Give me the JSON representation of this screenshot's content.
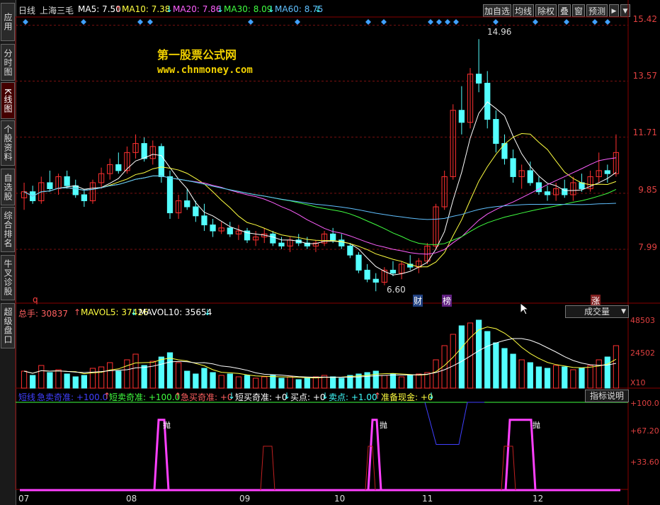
{
  "sidebar": {
    "tabs": [
      {
        "label": "应用",
        "active": false
      },
      {
        "label": "分时图",
        "active": false
      },
      {
        "label": "K线图",
        "active": true
      },
      {
        "label": "个股资料",
        "active": false
      },
      {
        "label": "自选股",
        "active": false
      },
      {
        "label": "综合排名",
        "active": false
      },
      {
        "label": "牛叉诊股",
        "active": false
      },
      {
        "label": "超级盘口",
        "active": false
      }
    ]
  },
  "main_header": {
    "period": "日线",
    "stock_name": "上海三毛",
    "ma5": "MA5: 7.50",
    "ma10": "MA10: 7.38",
    "ma20": "MA20: 7.86",
    "ma30": "MA30: 8.09",
    "ma60": "MA60: 8.75",
    "arrow_down": "↓",
    "arrow_up": "↑"
  },
  "toolbar": {
    "add_watch": "加自选",
    "avg_line": "均线",
    "exright": "除权",
    "overlay": "叠",
    "window": "窗",
    "forecast": "预测",
    "arrow": "▶",
    "menu": "▼"
  },
  "watermark": {
    "title": "第一股票公式网",
    "url": "www.chnmoney.com"
  },
  "price_axis": [
    "15.42",
    "13.57",
    "11.71",
    "9.85",
    "7.99"
  ],
  "annotations": {
    "high": "14.96",
    "low": "6.60",
    "marker_q": "q",
    "marker_cai": "财",
    "marker_bang": "榜",
    "marker_zhang": "涨"
  },
  "volume_header": {
    "total": "总手: 30837",
    "mavol5": "MAVOL5: 37426",
    "mavol10": "MAVOL10: 35654",
    "selector": "成交量",
    "axis": [
      "48503",
      "24502"
    ],
    "unit": "X10"
  },
  "indicator_header": {
    "l1": "短线",
    "l1b": "急卖奇准: +100.0",
    "l2": "短卖奇准: +100.0",
    "l3": "急买奇准: +0",
    "l4": "短买奇准: +0",
    "l5": "买点: +0",
    "l6": "卖点: +1.00",
    "l7": "准备现金: +0",
    "help": "指标说明",
    "axis": [
      "+100.0",
      "+67.20",
      "+33.60"
    ],
    "label_a": "抛",
    "label_b": "抛",
    "label_c": "抛"
  },
  "date_axis": [
    "07",
    "08",
    "09",
    "10",
    "11",
    "12"
  ],
  "colors": {
    "up": "#ff3030",
    "down": "#54ffff",
    "ma5": "#ffffff",
    "ma10": "#ffff40",
    "ma20": "#ff60ff",
    "ma30": "#40ff40",
    "ma60": "#60c0ff",
    "axis": "#e04040"
  },
  "chart_data": {
    "type": "candlestick",
    "ohlc": [
      [
        9.7,
        10.2,
        9.3,
        9.9
      ],
      [
        9.9,
        10.1,
        9.5,
        9.6
      ],
      [
        9.6,
        10.4,
        9.5,
        10.2
      ],
      [
        10.2,
        10.6,
        9.9,
        10.0
      ],
      [
        10.0,
        10.5,
        9.8,
        10.4
      ],
      [
        10.4,
        10.6,
        10.0,
        10.1
      ],
      [
        10.1,
        10.3,
        9.7,
        9.8
      ],
      [
        9.8,
        10.0,
        9.4,
        9.6
      ],
      [
        9.6,
        10.3,
        9.5,
        10.2
      ],
      [
        10.2,
        10.7,
        10.0,
        10.5
      ],
      [
        10.5,
        11.0,
        10.3,
        10.8
      ],
      [
        10.8,
        11.2,
        10.5,
        10.6
      ],
      [
        10.6,
        11.4,
        10.5,
        11.2
      ],
      [
        11.2,
        11.8,
        11.0,
        11.5
      ],
      [
        11.5,
        11.7,
        10.9,
        11.0
      ],
      [
        11.0,
        11.6,
        10.8,
        11.4
      ],
      [
        11.4,
        11.5,
        10.2,
        10.4
      ],
      [
        10.4,
        10.6,
        9.0,
        9.2
      ],
      [
        9.2,
        9.8,
        9.0,
        9.6
      ],
      [
        9.6,
        10.0,
        9.3,
        9.4
      ],
      [
        9.4,
        9.6,
        8.9,
        9.1
      ],
      [
        9.1,
        9.5,
        8.6,
        8.8
      ],
      [
        8.8,
        9.0,
        8.4,
        8.6
      ],
      [
        8.6,
        8.9,
        8.5,
        8.7
      ],
      [
        8.7,
        8.9,
        8.4,
        8.5
      ],
      [
        8.5,
        8.8,
        8.3,
        8.6
      ],
      [
        8.6,
        8.7,
        8.2,
        8.3
      ],
      [
        8.3,
        8.6,
        8.1,
        8.4
      ],
      [
        8.4,
        8.7,
        8.2,
        8.5
      ],
      [
        8.5,
        8.6,
        8.1,
        8.2
      ],
      [
        8.2,
        8.4,
        8.0,
        8.1
      ],
      [
        8.1,
        8.4,
        7.9,
        8.3
      ],
      [
        8.3,
        8.5,
        8.1,
        8.2
      ],
      [
        8.2,
        8.4,
        8.0,
        8.1
      ],
      [
        8.1,
        8.3,
        7.9,
        8.2
      ],
      [
        8.2,
        8.6,
        8.1,
        8.5
      ],
      [
        8.5,
        8.7,
        8.2,
        8.3
      ],
      [
        8.3,
        8.5,
        8.0,
        8.1
      ],
      [
        8.1,
        8.2,
        7.7,
        7.8
      ],
      [
        7.8,
        7.9,
        7.2,
        7.3
      ],
      [
        7.3,
        7.5,
        6.9,
        7.0
      ],
      [
        7.0,
        7.2,
        6.6,
        6.9
      ],
      [
        6.9,
        7.4,
        6.8,
        7.3
      ],
      [
        7.3,
        7.6,
        7.1,
        7.2
      ],
      [
        7.2,
        7.6,
        7.0,
        7.5
      ],
      [
        7.5,
        7.8,
        7.3,
        7.4
      ],
      [
        7.4,
        7.7,
        7.2,
        7.6
      ],
      [
        7.6,
        8.2,
        7.5,
        8.1
      ],
      [
        8.1,
        9.5,
        8.0,
        9.4
      ],
      [
        9.4,
        10.6,
        9.3,
        10.4
      ],
      [
        10.4,
        12.8,
        10.3,
        12.6
      ],
      [
        12.6,
        13.4,
        11.8,
        12.2
      ],
      [
        12.2,
        14.0,
        12.0,
        13.8
      ],
      [
        13.8,
        14.96,
        13.2,
        13.5
      ],
      [
        13.5,
        13.9,
        12.0,
        12.3
      ],
      [
        12.3,
        12.6,
        11.2,
        11.5
      ],
      [
        11.5,
        11.8,
        10.8,
        11.0
      ],
      [
        11.0,
        11.3,
        10.2,
        10.4
      ],
      [
        10.4,
        10.8,
        10.0,
        10.6
      ],
      [
        10.6,
        10.9,
        10.1,
        10.2
      ],
      [
        10.2,
        10.4,
        9.8,
        9.9
      ],
      [
        9.9,
        10.1,
        9.6,
        9.8
      ],
      [
        9.8,
        10.2,
        9.6,
        10.0
      ],
      [
        10.0,
        10.3,
        9.7,
        9.8
      ],
      [
        9.8,
        10.4,
        9.6,
        10.2
      ],
      [
        10.2,
        10.5,
        9.9,
        10.0
      ],
      [
        10.0,
        10.6,
        9.9,
        10.4
      ],
      [
        10.4,
        11.2,
        10.2,
        10.6
      ],
      [
        10.6,
        10.8,
        10.2,
        10.5
      ],
      [
        10.5,
        11.8,
        10.4,
        11.2
      ]
    ],
    "volume": [
      12,
      9,
      16,
      11,
      13,
      10,
      8,
      9,
      14,
      15,
      18,
      12,
      20,
      24,
      16,
      19,
      22,
      25,
      18,
      12,
      10,
      14,
      11,
      9,
      10,
      8,
      9,
      7,
      8,
      9,
      7,
      8,
      6,
      7,
      8,
      9,
      8,
      7,
      9,
      10,
      11,
      12,
      9,
      10,
      8,
      9,
      10,
      11,
      20,
      30,
      38,
      44,
      46,
      48,
      40,
      32,
      28,
      24,
      20,
      18,
      15,
      14,
      16,
      15,
      13,
      14,
      16,
      20,
      22,
      30
    ],
    "ylim": [
      6.3,
      15.6
    ],
    "vol_max": 48503
  }
}
